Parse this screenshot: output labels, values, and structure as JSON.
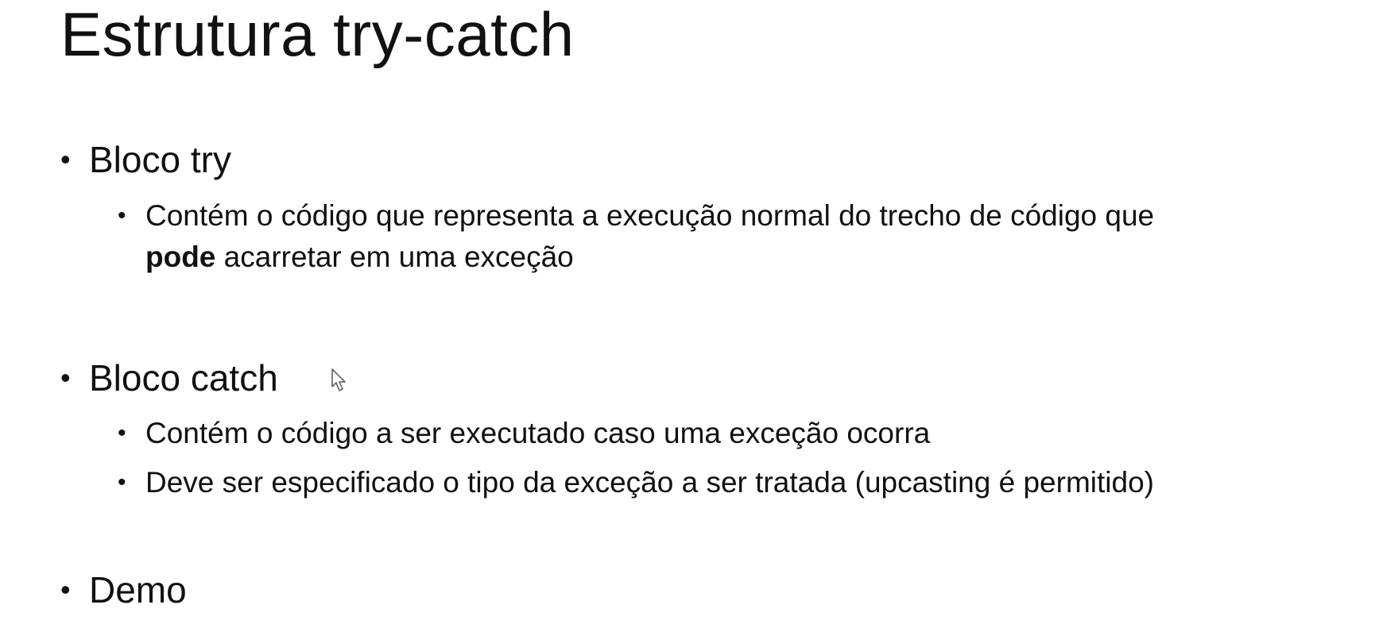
{
  "slide": {
    "title": "Estrutura try-catch",
    "bullet_glyph": "•",
    "sections": [
      {
        "label": "Bloco try",
        "items": [
          {
            "line1": "Contém o código que representa a execução normal do trecho de código que",
            "line2_bold": "pode",
            "line2_rest": " acarretar em uma exceção"
          }
        ]
      },
      {
        "label": "Bloco catch",
        "items": [
          {
            "text": "Contém o código a ser executado caso uma exceção ocorra"
          },
          {
            "text": "Deve ser especificado o tipo da exceção a ser tratada (upcasting é permitido)"
          }
        ]
      },
      {
        "label": "Demo"
      }
    ]
  },
  "cursor_icon": "mouse-pointer-icon"
}
